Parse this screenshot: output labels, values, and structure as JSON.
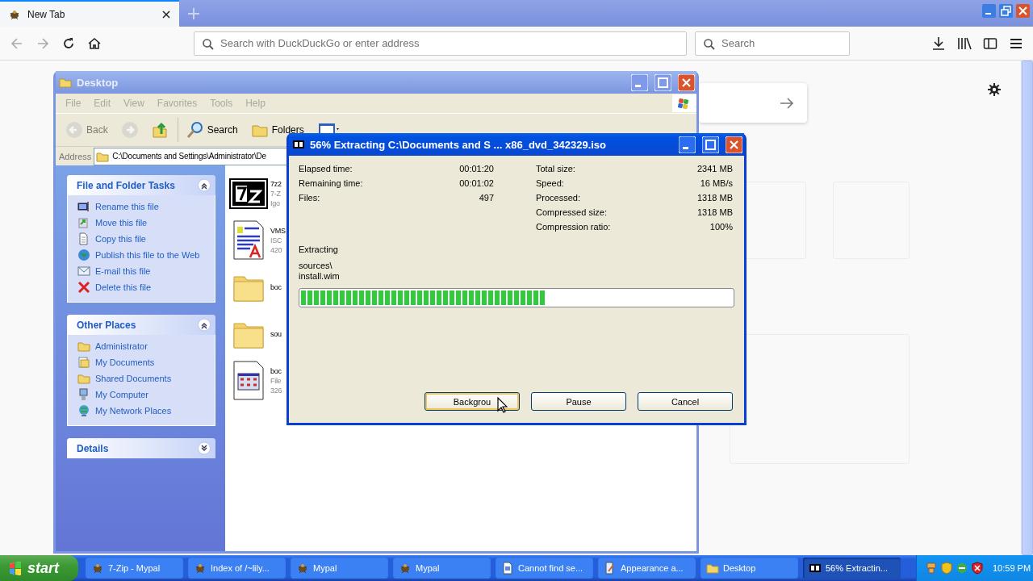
{
  "browser": {
    "tabs": [
      {
        "label": "New Tab",
        "selected": true
      }
    ],
    "address_bar": {
      "placeholder": "Search with DuckDuckGo or enter address"
    },
    "search_bar": {
      "placeholder": "Search"
    }
  },
  "explorer": {
    "title": "Desktop",
    "menu": [
      "File",
      "Edit",
      "View",
      "Favorites",
      "Tools",
      "Help"
    ],
    "toolbar": [
      {
        "kind": "back",
        "label": "Back",
        "disabled": true
      },
      {
        "kind": "forward",
        "disabled": true
      },
      {
        "kind": "up",
        "disabled": false
      },
      {
        "kind": "search",
        "label": "Search",
        "disabled": false
      },
      {
        "kind": "folders",
        "label": "Folders",
        "disabled": false
      },
      {
        "kind": "views",
        "disabled": false
      }
    ],
    "address": {
      "label": "Address",
      "value": "C:\\Documents and Settings\\Administrator\\De"
    },
    "panels": [
      {
        "title": "File and Folder Tasks",
        "expanded": true,
        "items": [
          {
            "kind": "rename",
            "label": "Rename this file"
          },
          {
            "kind": "move",
            "label": "Move this file"
          },
          {
            "kind": "copy",
            "label": "Copy this file"
          },
          {
            "kind": "globe",
            "label": "Publish this file to the Web"
          },
          {
            "kind": "mail",
            "label": "E-mail this file"
          },
          {
            "kind": "delete",
            "label": "Delete this file"
          }
        ]
      },
      {
        "title": "Other Places",
        "expanded": true,
        "items": [
          {
            "kind": "folder",
            "label": "Administrator"
          },
          {
            "kind": "documents",
            "label": "My Documents"
          },
          {
            "kind": "folder",
            "label": "Shared Documents"
          },
          {
            "kind": "computer",
            "label": "My Computer"
          },
          {
            "kind": "network",
            "label": "My Network Places"
          }
        ]
      },
      {
        "title": "Details",
        "expanded": false
      }
    ],
    "files": [
      {
        "kind": "archive",
        "lines": [
          "7z2",
          "7-Z",
          "Igo"
        ]
      },
      {
        "kind": "document",
        "lines": [
          "VMS",
          "ISC",
          "420"
        ]
      },
      {
        "kind": "folder",
        "lines": [
          "boc"
        ]
      },
      {
        "kind": "folder",
        "lines": [
          "sou"
        ]
      },
      {
        "kind": "settings",
        "lines": [
          "boc",
          "File",
          "326"
        ]
      }
    ]
  },
  "dialog": {
    "title": "56% Extracting C:\\Documents and S ... x86_dvd_342329.iso",
    "left_stats": [
      {
        "label": "Elapsed time:",
        "value": "00:01:20"
      },
      {
        "label": "Remaining time:",
        "value": "00:01:02"
      },
      {
        "label": "Files:",
        "value": "497"
      }
    ],
    "right_stats": [
      {
        "label": "Total size:",
        "value": "2341 MB"
      },
      {
        "label": "Speed:",
        "value": "16 MB/s"
      },
      {
        "label": "Processed:",
        "value": "1318 MB"
      },
      {
        "label": "Compressed size:",
        "value": "1318 MB"
      },
      {
        "label": "Compression ratio:",
        "value": "100%"
      }
    ],
    "status": "Extracting",
    "path": "sources\\",
    "file": "install.wim",
    "progress": {
      "level": 0.57
    },
    "buttons": [
      {
        "label": "Backgrou",
        "focused": true
      },
      {
        "label": "Pause",
        "focused": false
      },
      {
        "label": "Cancel",
        "focused": false
      }
    ]
  },
  "taskbar": {
    "start": "start",
    "items": [
      {
        "kind": "browser",
        "label": "7-Zip - Mypal",
        "selected": false
      },
      {
        "kind": "browser",
        "label": "Index of /~lily...",
        "selected": false
      },
      {
        "kind": "browser",
        "label": "Mypal",
        "selected": false
      },
      {
        "kind": "browser",
        "label": "Mypal",
        "selected": false
      },
      {
        "kind": "page",
        "label": "Cannot find se...",
        "selected": false
      },
      {
        "kind": "settings",
        "label": "Appearance a...",
        "selected": false
      },
      {
        "kind": "folder",
        "label": "Desktop",
        "selected": false
      },
      {
        "kind": "archive",
        "label": "56% Extractin...",
        "selected": true
      }
    ],
    "clock": "10:59 PM"
  }
}
